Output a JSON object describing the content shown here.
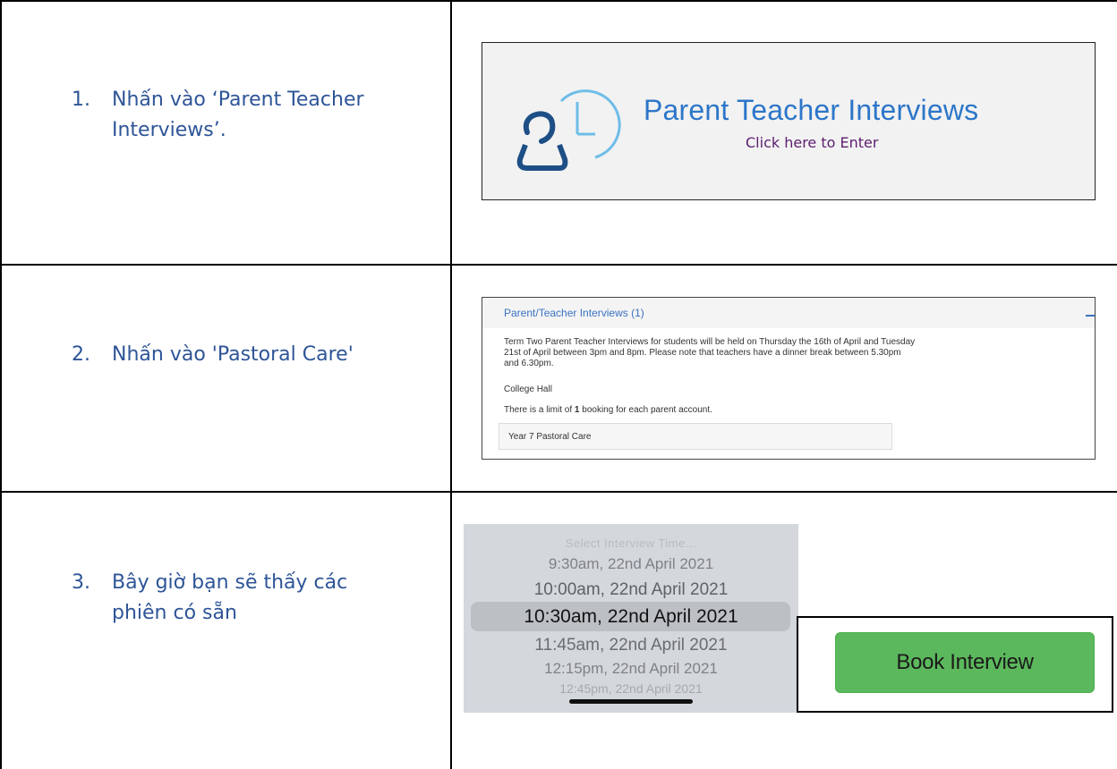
{
  "steps": [
    {
      "number": "1.",
      "text_line1": "Nhấn vào ‘Parent Teacher",
      "text_line2": "Interviews’."
    },
    {
      "number": "2.",
      "text_line1": "Nhấn vào 'Pastoral Care'"
    },
    {
      "number": "3.",
      "text_line1": "Bây giờ bạn sẽ thấy các",
      "text_line2": "phiên có sẵn"
    }
  ],
  "pti_banner": {
    "title": "Parent Teacher Interviews",
    "subtitle": "Click here to Enter",
    "icon": "person-clock-icon",
    "title_color": "#2c76c9",
    "subtitle_color": "#5c1e6e"
  },
  "interview_panel": {
    "title": "Parent/Teacher Interviews (1)",
    "description": "Term Two Parent Teacher Interviews for students will be held on Thursday the 16th of April and Tuesday 21st of April between 3pm and 8pm. Please note that teachers have a dinner break between 5.30pm and 6.30pm.",
    "location": "College Hall",
    "limit_prefix": "There is a limit of ",
    "limit_count": "1",
    "limit_suffix": " booking for each parent account.",
    "item_label": "Year 7 Pastoral Care",
    "collapse_icon": "minus-icon"
  },
  "time_picker": {
    "placeholder": "Select Interview Time...",
    "options": [
      "9:30am, 22nd April 2021",
      "10:00am, 22nd April 2021",
      "10:30am, 22nd April 2021",
      "11:45am, 22nd April 2021",
      "12:15pm, 22nd April 2021",
      "12:45pm, 22nd April 2021"
    ],
    "selected": "10:30am, 22nd April 2021"
  },
  "book_button": {
    "label": "Book Interview",
    "color": "#5cb85c"
  }
}
